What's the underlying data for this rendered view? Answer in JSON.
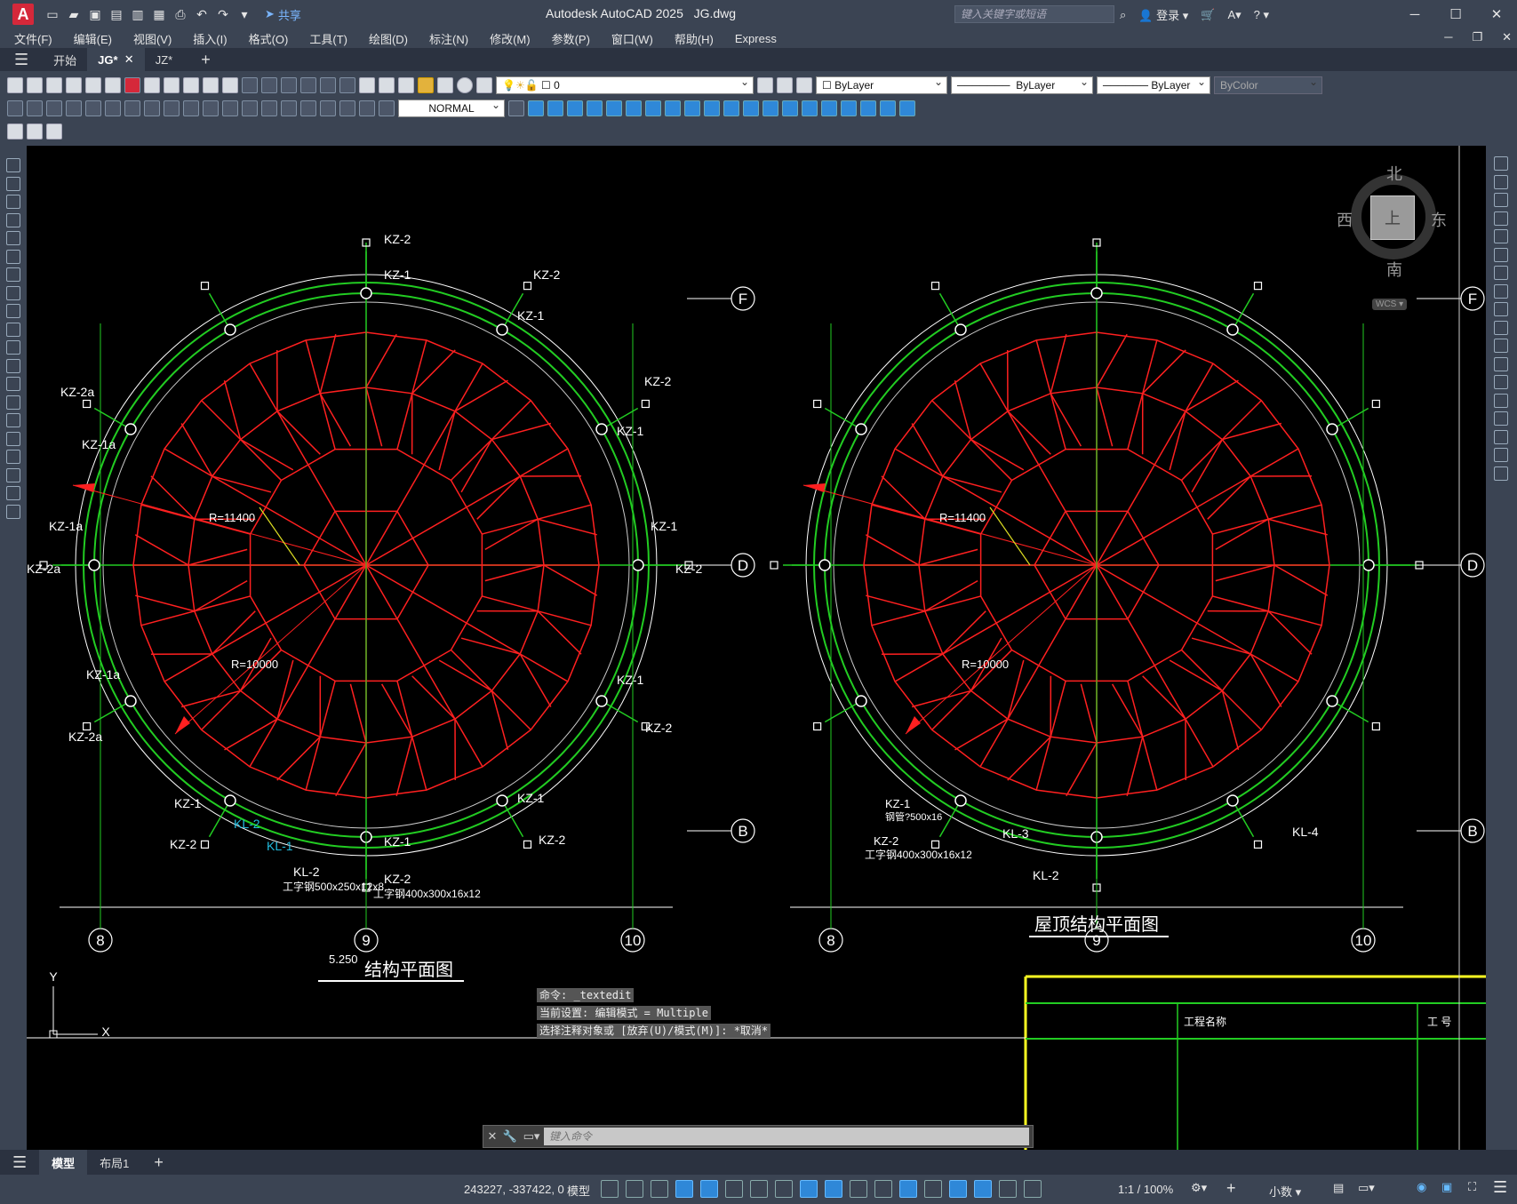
{
  "app": {
    "title": "Autodesk AutoCAD 2025",
    "file": "JG.dwg",
    "search_placeholder": "键入关键字或短语",
    "login": "登录",
    "share": "共享",
    "logo": "A"
  },
  "menu": [
    "文件(F)",
    "编辑(E)",
    "视图(V)",
    "插入(I)",
    "格式(O)",
    "工具(T)",
    "绘图(D)",
    "标注(N)",
    "修改(M)",
    "参数(P)",
    "窗口(W)",
    "帮助(H)",
    "Express"
  ],
  "tabs": {
    "start": "开始",
    "items": [
      {
        "label": "JG*",
        "active": true
      },
      {
        "label": "JZ*",
        "active": false
      }
    ]
  },
  "properties": {
    "layer": "0",
    "color": "ByLayer",
    "linetype": "ByLayer",
    "lineweight": "ByLayer",
    "plotstyle": "ByColor",
    "dimstyle": "NORMAL"
  },
  "viewcube": {
    "north": "北",
    "south": "南",
    "east": "东",
    "west": "西",
    "top": "上",
    "wcs": "WCS"
  },
  "drawing": {
    "left_plan": {
      "title": "结构平面图",
      "level": "5.250",
      "radius_outer": "R=11400",
      "radius_inner": "R=10000",
      "col_labels": [
        "KZ-2",
        "KZ-1",
        "KZ-2",
        "KZ-1",
        "KZ-2",
        "KZ-1",
        "KZ-2a",
        "KZ-1a",
        "KZ-1a",
        "KZ-2a",
        "KZ-1",
        "KZ-2",
        "KZ-1a",
        "KZ-2a",
        "KZ-1",
        "KZ-2",
        "KZ-1",
        "KZ-2",
        "KZ-1",
        "KZ-2",
        "KZ-1",
        "KZ-2"
      ],
      "beam_labels": [
        "KL-2",
        "KL-1",
        "KL-2"
      ],
      "notes": [
        "工字钢500x250x12x8",
        "工字钢400x300x16x12"
      ]
    },
    "right_plan": {
      "title": "屋顶结构平面图",
      "radius_outer": "R=11400",
      "radius_inner": "R=10000",
      "labels": [
        "KZ-1",
        "钢管?500x16",
        "KZ-2",
        "工字钢400x300x16x12",
        "KL-3",
        "KL-2",
        "KL-4"
      ]
    },
    "axes": {
      "rows": [
        "F",
        "D",
        "B"
      ],
      "cols": [
        "8",
        "9",
        "10"
      ]
    },
    "titleblock": {
      "project_name": "工程名称",
      "project_no": "工 号"
    },
    "ucs": {
      "x": "X",
      "y": "Y"
    }
  },
  "command": {
    "history": [
      "命令: _textedit",
      "当前设置: 编辑模式 = Multiple",
      "选择注释对象或 [放弃(U)/模式(M)]: *取消*"
    ],
    "placeholder": "键入命令"
  },
  "layout_tabs": {
    "model": "模型",
    "layout1": "布局1"
  },
  "status": {
    "coords": "243227, -337422, 0",
    "space": "模型",
    "scale": "1:1 / 100%",
    "units": "小数"
  }
}
